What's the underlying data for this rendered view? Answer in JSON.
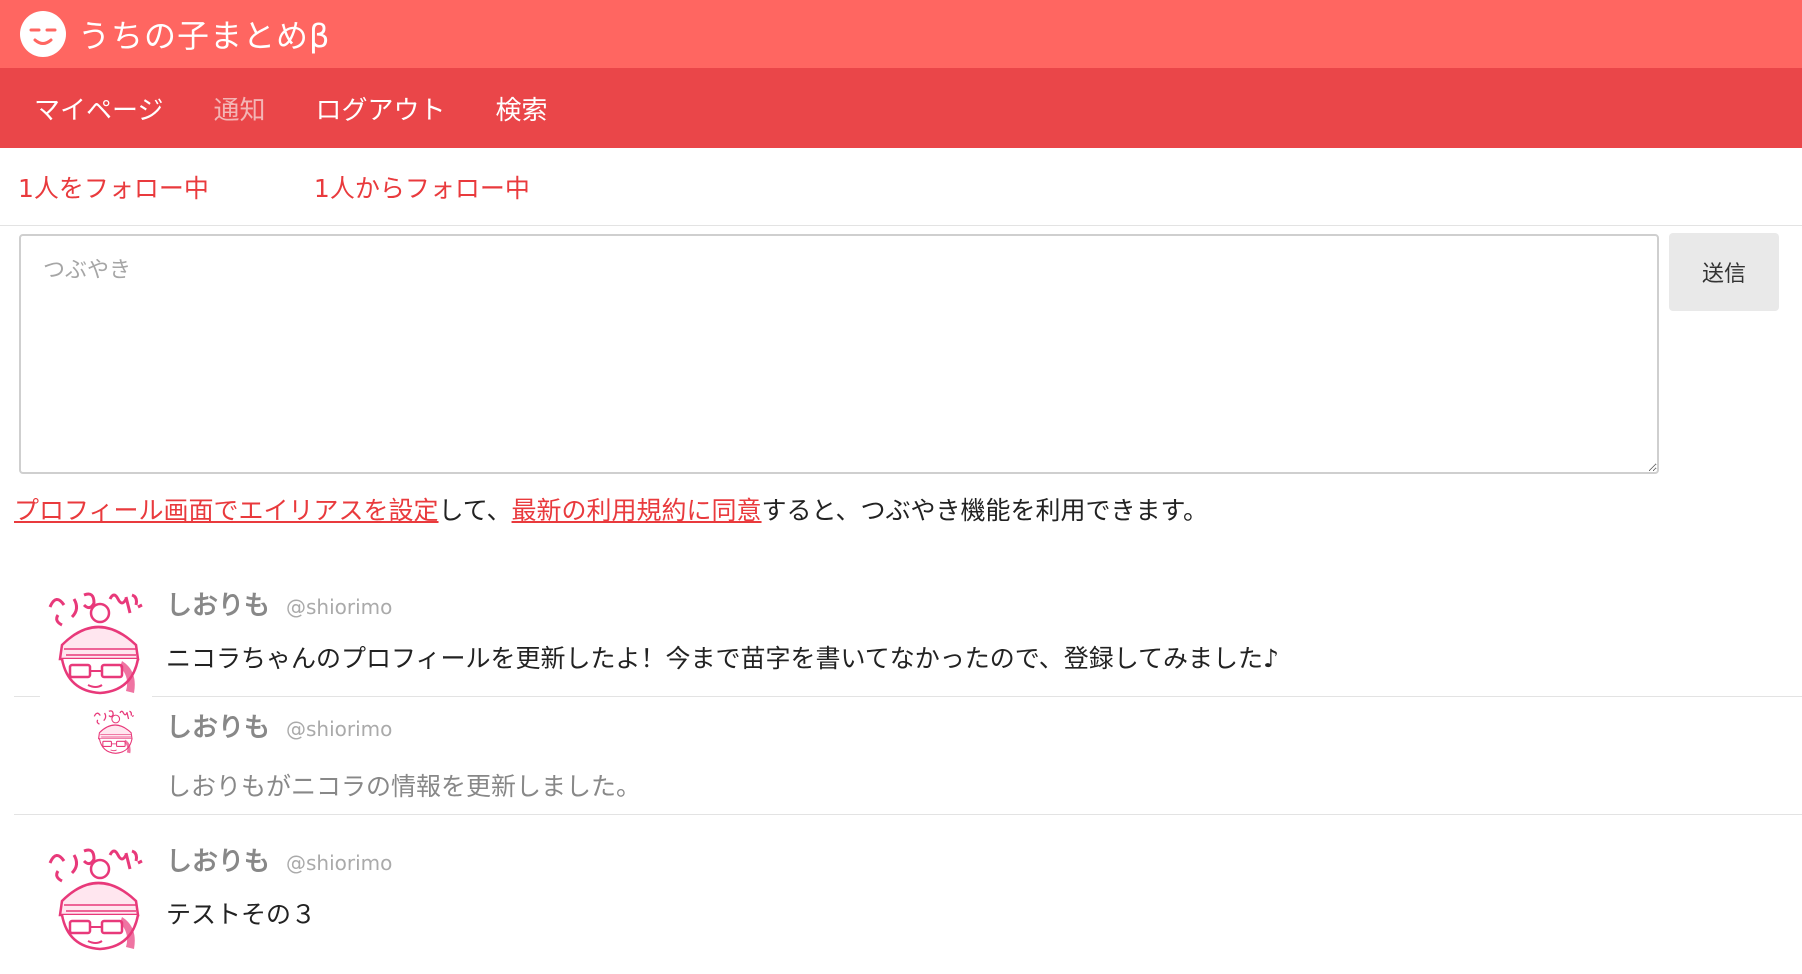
{
  "header": {
    "site_title": "うちの子まとめβ",
    "logo_icon": "smiley-face-icon",
    "colors": {
      "topbar": "#ff6661",
      "navbar": "#ea4649",
      "accent": "#e93a3d"
    }
  },
  "nav": {
    "items": [
      {
        "label": "マイページ"
      },
      {
        "label": "通知"
      },
      {
        "label": "ログアウト"
      },
      {
        "label": "検索"
      }
    ]
  },
  "follow": {
    "following": "1人をフォロー中",
    "followers": "1人からフォロー中"
  },
  "compose": {
    "placeholder": "つぶやき",
    "send_label": "送信"
  },
  "notice": {
    "link1": "プロフィール画面でエイリアスを設定",
    "text1": "して、",
    "link2": "最新の利用規約に同意",
    "text2": "すると、つぶやき機能を利用できます。"
  },
  "posts": [
    {
      "name": "しおりも",
      "handle": "@shiorimo",
      "text": "ニコラちゃんのプロフィールを更新したよ！今まで苗字を書いてなかったので、登録してみました♪",
      "avatar_icon": "avatar-illustration-icon"
    },
    {
      "name": "しおりも",
      "handle": "@shiorimo",
      "text": "しおりもがニコラの情報を更新しました。",
      "avatar_icon": "avatar-illustration-icon"
    },
    {
      "name": "しおりも",
      "handle": "@shiorimo",
      "text": "テストその３",
      "avatar_icon": "avatar-illustration-icon"
    }
  ]
}
